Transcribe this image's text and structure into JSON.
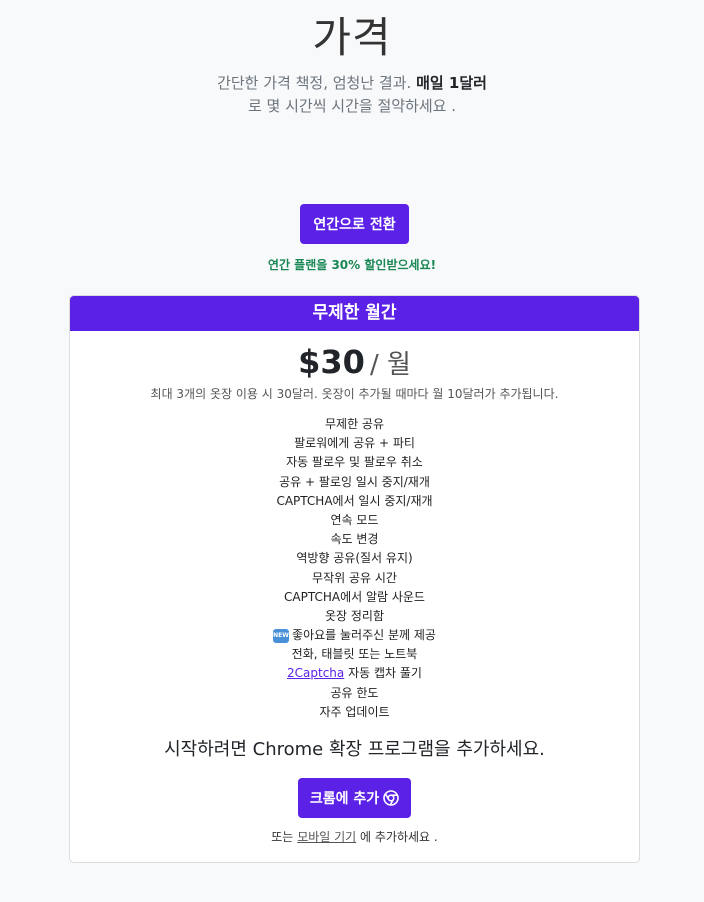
{
  "header": {
    "title": "가격",
    "lead_line1": "간단한 가격 책정, 엄청난 결과.",
    "lead_bold": "매일 1달러",
    "lead_line2": "로 몇 시간씩 시간을 절약하세요 ."
  },
  "billing_toggle": {
    "button_label": "연간으로 전환",
    "discount_note": "연간 플랜을 30% 할인받으세요!"
  },
  "plan": {
    "name": "무제한 월간",
    "price": "$30",
    "period": "/ 월",
    "note": "최대 3개의 옷장 이용 시 30달러. 옷장이 추가될 때마다 월 10달러가 추가됩니다.",
    "features": [
      "무제한 공유",
      "팔로워에게 공유 + 파티",
      "자동 팔로우 및 팔로우 취소",
      "공유 + 팔로잉 일시 중지/재개",
      "CAPTCHA에서 일시 중지/재개",
      "연속 모드",
      "속도 변경",
      "역방향 공유(질서 유지)",
      "무작위 공유 시간",
      "CAPTCHA에서 알람 사운드",
      "옷장 정리함"
    ],
    "new_badge": "NEW",
    "new_feature": "좋아요를 눌러주신 분께 제공",
    "feature_devices": "전화, 태블릿 또는 노트북",
    "captcha_link": "2Captcha",
    "captcha_feature": "자동 캡차 풀기",
    "feature_limits": "공유 한도",
    "feature_updates": "자주 업데이트",
    "cta": "시작하려면 Chrome 확장 프로그램을 추가하세요.",
    "add_button": "크롬에 추가",
    "footer_prefix": "또는",
    "footer_link": "모바일 기기",
    "footer_suffix": "에 추가하세요 ."
  },
  "colors": {
    "accent": "#5b21e6",
    "discount": "#198754"
  }
}
